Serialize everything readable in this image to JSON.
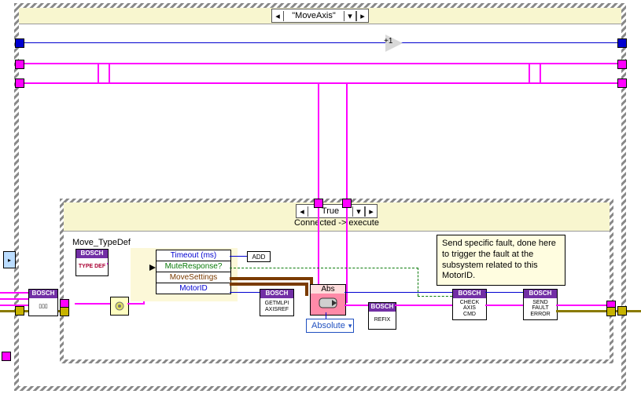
{
  "outer_case": {
    "selector_label": "\"MoveAxis\""
  },
  "inner_case": {
    "selector_label": "True",
    "subtitle": "Connected -> execute"
  },
  "typedef": {
    "label": "Move_TypeDef",
    "node_header": "BOSCH",
    "node_body": "TYPE DEF"
  },
  "unbundle": {
    "items": [
      {
        "text": "Timeout (ms)",
        "color": "#0000d0"
      },
      {
        "text": "MuteResponse?",
        "color": "#0a7a0a"
      },
      {
        "text": "MoveSettings",
        "color": "#7a3b00"
      },
      {
        "text": "MotorID",
        "color": "#0000d0"
      }
    ]
  },
  "add_label": "ADD",
  "abs_label": "Abs",
  "absolute_dropdown": "Absolute",
  "plus_one": "+1",
  "nodes": {
    "left_vi": {
      "hdr": "BOSCH",
      "body": ""
    },
    "getmlpi": {
      "hdr": "BOSCH",
      "body": "GETMLPI\nAXISREF"
    },
    "refix": {
      "hdr": "BOSCH",
      "body": "REFIX"
    },
    "checkaxis": {
      "hdr": "BOSCH",
      "body": "CHECK\nAXIS\nCMD"
    },
    "sendfault": {
      "hdr": "BOSCH",
      "body": "SEND\nFAULT\nERROR"
    }
  },
  "comment": "Send specific fault, done here to trigger the fault at the subsystem related to this MotorID."
}
